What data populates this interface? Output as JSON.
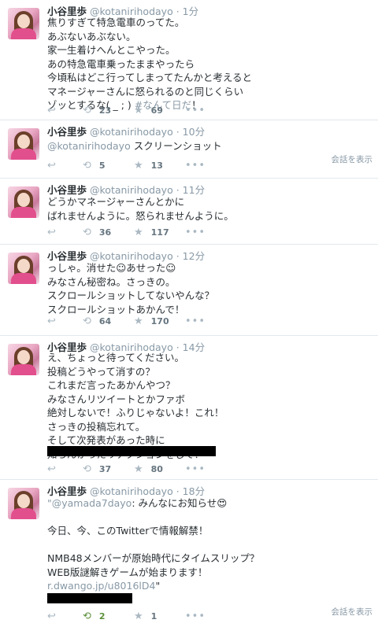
{
  "user": {
    "name": "小谷里歩",
    "handle": "@kotanirihodayo"
  },
  "conversation_label": "会話を表示",
  "tweets": [
    {
      "time": "· 1分",
      "lines": [
        "焦りすぎて特急電車のってた。",
        "あぶないあぶない。",
        "家一生着けへんとこやった。",
        "あの特急電車乗ったままやったら",
        "今頃私はどこ行ってしまってたんかと考えると",
        "マネージャーさんに怒られるのと同じくらい"
      ],
      "last_line_text": "ゾッとするな( _ ; ) ",
      "hashtag": "#なんて日だ",
      "last_line_suffix": "！",
      "retweets": "23",
      "favorites": "69"
    },
    {
      "time": "· 10分",
      "mention": "@kotanirihodayo",
      "text": " スクリーンショット",
      "retweets": "5",
      "favorites": "13"
    },
    {
      "time": "· 11分",
      "lines": [
        "どうかマネージャーさんとかに",
        "ばれませんように。怒られませんように。"
      ],
      "retweets": "36",
      "favorites": "117"
    },
    {
      "time": "· 12分",
      "lines": [
        "っしゃ。消せた☺あせった☺",
        "みなさん秘密ね。さっきの。",
        "スクロールショットしてないやんな？",
        "スクロールショットあかんで！"
      ],
      "retweets": "64",
      "favorites": "170"
    },
    {
      "time": "· 14分",
      "lines": [
        "え、ちょっと待ってください。",
        "投稿どうやって消すの？",
        "これまだ言ったあかんやつ？",
        "みなさんリツイートとかファボ",
        "絶対しないで！ふりじゃないよ！これ！",
        "さっきの投稿忘れて。",
        "そして次発表があった時に",
        "知らんかったリアクションをして！"
      ],
      "retweets": "37",
      "favorites": "80"
    },
    {
      "time": "· 18分",
      "quote_open": "\"",
      "mention": "@yamada7dayo",
      "quote_text": ": みんなにお知らせ😍",
      "lines": [
        "今日、今、このTwitterで情報解禁！",
        "",
        "NMB48メンバーが原始時代にタイムスリップ？",
        "WEB版謎解きゲームが始まります！"
      ],
      "link": "r.dwango.jp/u8016lD4",
      "quote_close": "\"",
      "retweets": "2",
      "favorites": "1"
    }
  ],
  "icons": {
    "reply": "reply-icon",
    "retweet": "retweet-icon",
    "favorite": "star-icon",
    "more": "more-icon"
  }
}
